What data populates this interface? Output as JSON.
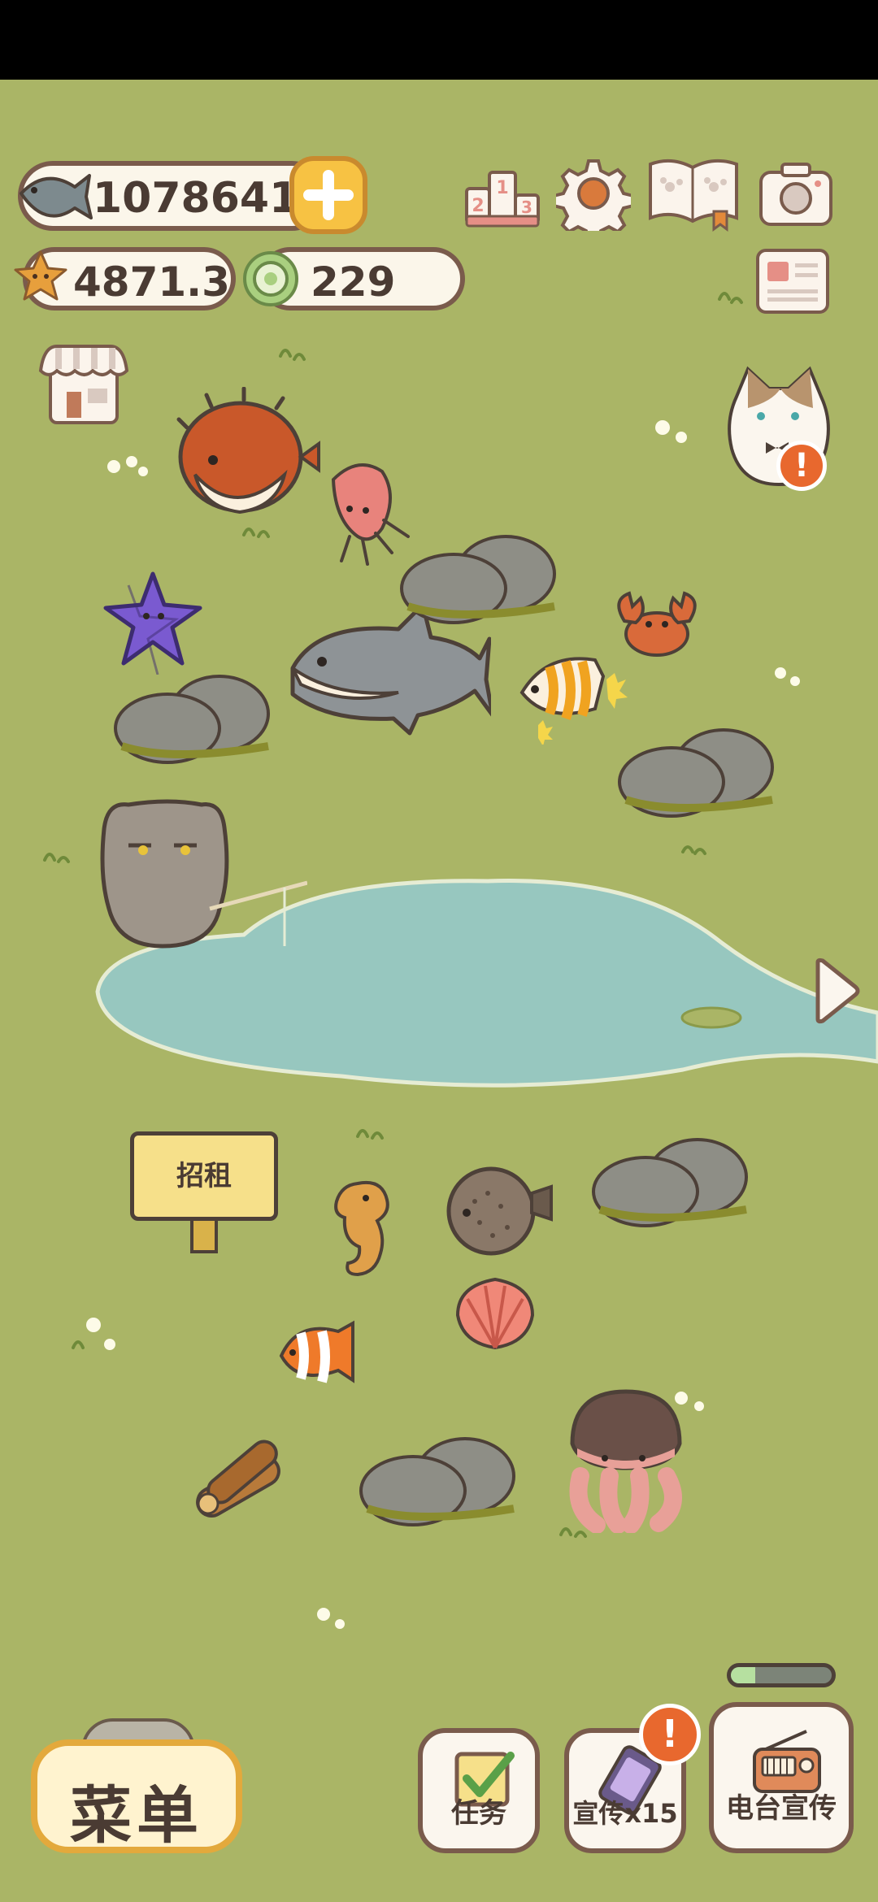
{
  "currency": {
    "fish": "1078641",
    "stars": "4871.3",
    "shells": "229"
  },
  "sign": {
    "text": "招租"
  },
  "buttons": {
    "menu": "菜单",
    "tasks": "任务",
    "promo": "宣传x15",
    "radio": "电台宣传"
  },
  "badges": {
    "cat": "!",
    "promo": "!"
  },
  "colors": {
    "grass": "#aab566",
    "pond": "#97c7bf",
    "outline": "#7a5b4c",
    "accent": "#f5c44a",
    "badge": "#e8682e"
  },
  "icons": [
    "fish-icon",
    "plus-icon",
    "star-icon",
    "shell-icon",
    "ranking-icon",
    "gear-icon",
    "book-icon",
    "camera-icon",
    "newspaper-icon",
    "shop-icon",
    "arrow-right-icon",
    "checklist-icon",
    "phone-icon",
    "radio-icon"
  ]
}
